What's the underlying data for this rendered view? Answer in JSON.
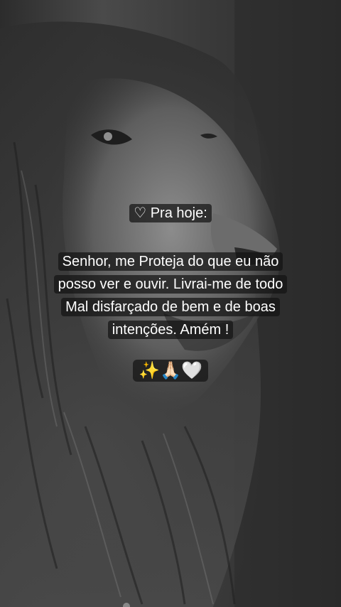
{
  "story": {
    "heading": "♡ Pra hoje:",
    "body_lines": [
      "Senhor, me Proteja do que eu não",
      "posso ver e ouvir. Livrai-me de todo",
      "Mal disfarçado de bem e de boas",
      "intenções. Amém !"
    ],
    "emoji": "✨🙏🏻🤍"
  },
  "background": {
    "subject": "lion-photo",
    "tone": "grayscale"
  }
}
